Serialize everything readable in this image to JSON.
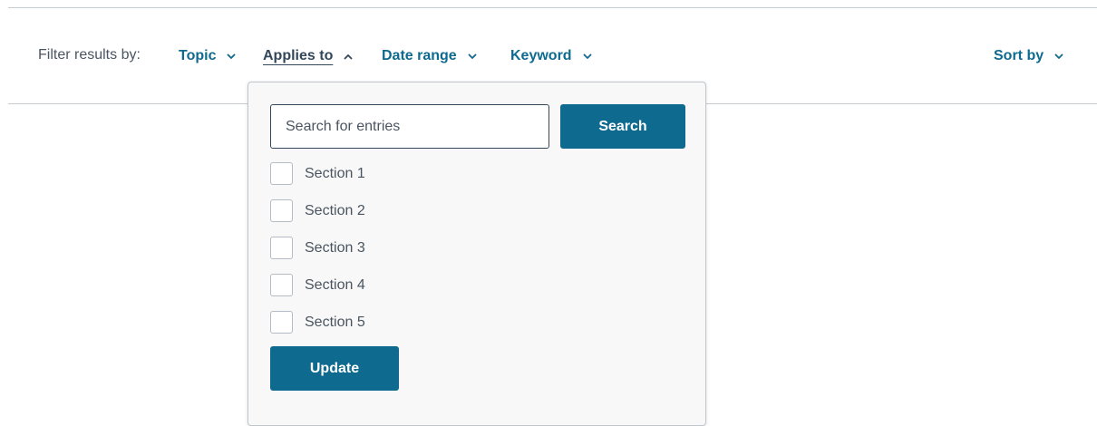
{
  "filter_bar": {
    "label": "Filter results by:",
    "filters": [
      {
        "label": "Topic",
        "expanded": false
      },
      {
        "label": "Applies to",
        "expanded": true
      },
      {
        "label": "Date range",
        "expanded": false
      },
      {
        "label": "Keyword",
        "expanded": false
      }
    ],
    "sort_label": "Sort by"
  },
  "dropdown": {
    "search": {
      "placeholder": "Search for entries",
      "value": ""
    },
    "search_button": "Search",
    "options": [
      {
        "label": "Section 1",
        "checked": false
      },
      {
        "label": "Section 2",
        "checked": false
      },
      {
        "label": "Section 3",
        "checked": false
      },
      {
        "label": "Section 4",
        "checked": false
      },
      {
        "label": "Section 5",
        "checked": false
      }
    ],
    "update_button": "Update"
  },
  "colors": {
    "accent": "#0f6a8f",
    "text": "#33475b",
    "muted_text": "#4a5561",
    "divider": "#c7ccd1",
    "panel_bg": "#f8f8f8"
  }
}
